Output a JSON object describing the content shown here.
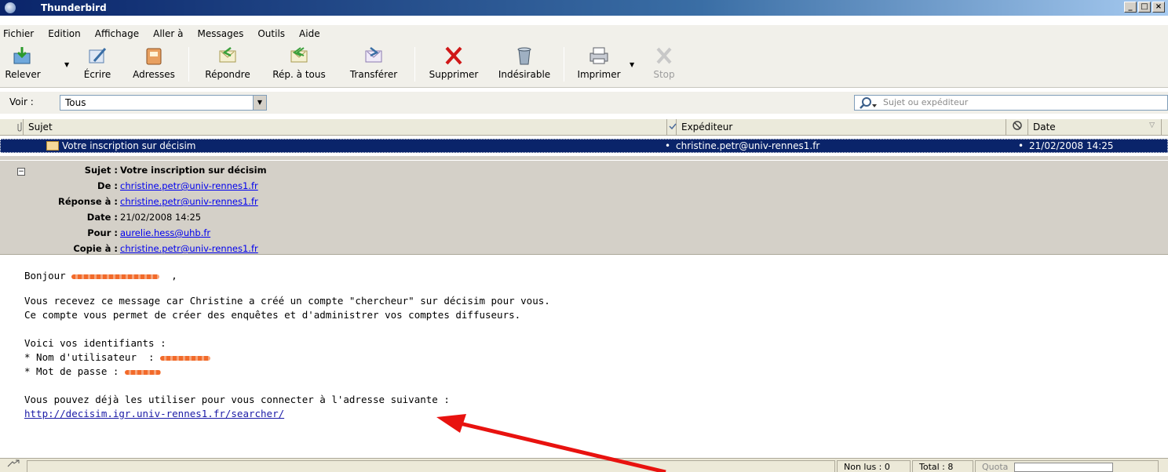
{
  "window": {
    "title": "Thunderbird",
    "controls": [
      "_",
      "□",
      "×"
    ]
  },
  "menu": [
    "Fichier",
    "Edition",
    "Affichage",
    "Aller à",
    "Messages",
    "Outils",
    "Aide"
  ],
  "toolbar": {
    "get_mail": "Relever",
    "write": "Écrire",
    "address_book": "Adresses",
    "reply": "Répondre",
    "reply_all": "Rép. à tous",
    "forward": "Transférer",
    "delete": "Supprimer",
    "junk": "Indésirable",
    "print": "Imprimer",
    "stop": "Stop"
  },
  "filter": {
    "label": "Voir :",
    "view_value": "Tous",
    "search_placeholder": "Sujet ou expéditeur"
  },
  "thread_columns": {
    "subject": "Sujet",
    "sender": "Expéditeur",
    "date": "Date"
  },
  "thread_rows": [
    {
      "subject": "Votre inscription sur décisim",
      "sender": "christine.petr@univ-rennes1.fr",
      "date": "21/02/2008 14:25"
    }
  ],
  "message_header": {
    "subject_label": "Sujet :",
    "subject": "Votre inscription sur décisim",
    "from_label": "De :",
    "from": "christine.petr@univ-rennes1.fr",
    "reply_to_label": "Réponse à :",
    "reply_to": "christine.petr@univ-rennes1.fr",
    "date_label": "Date :",
    "date": "21/02/2008 14:25",
    "to_label": "Pour :",
    "to": "aurelie.hess@uhb.fr",
    "cc_label": "Copie à :",
    "cc": "christine.petr@univ-rennes1.fr"
  },
  "message_body": {
    "greeting": "Bonjour",
    "greeting_suffix": ",",
    "line1": "Vous recevez ce message car Christine a créé un compte \"chercheur\" sur décisim pour vous.",
    "line2": "Ce compte vous permet de créer des enquêtes et d'administrer vos comptes diffuseurs.",
    "credentials_intro": "Voici vos identifiants :",
    "username_label": "* Nom d'utilisateur  :",
    "password_label": "* Mot de passe :",
    "connect_text": "Vous pouvez déjà les utiliser pour vous connecter à l'adresse suivante :",
    "url": "http://decisim.igr.univ-rennes1.fr/searcher/"
  },
  "status": {
    "unread": "Non lus : 0",
    "total": "Total : 8",
    "quota_label": "Quota"
  },
  "colors": {
    "selection": "#0a246a",
    "annotation_arrow": "#e8120f",
    "link": "#0000ee"
  }
}
